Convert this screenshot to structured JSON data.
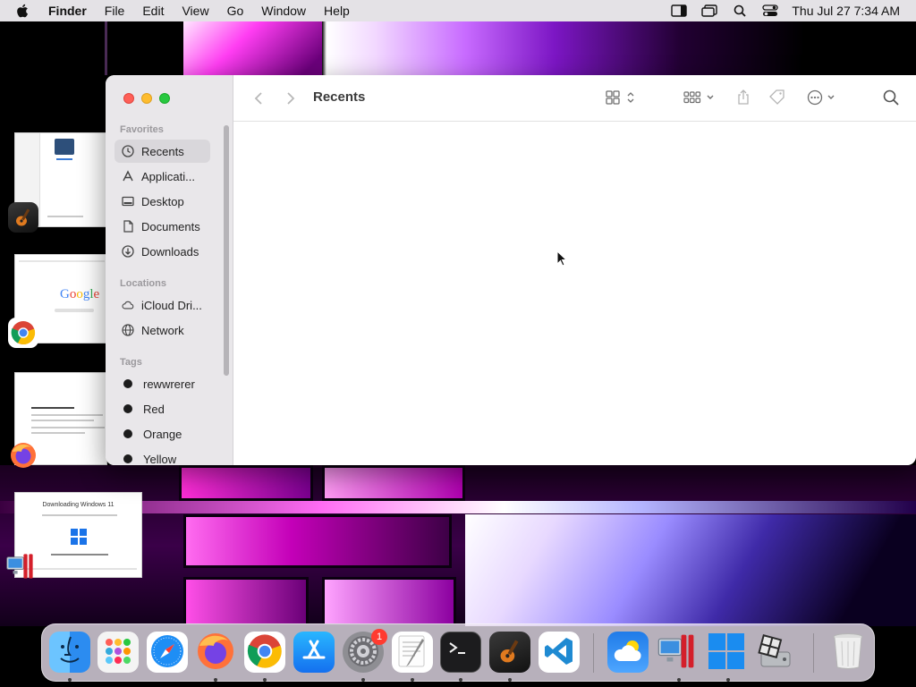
{
  "menubar": {
    "app_name": "Finder",
    "items": [
      "File",
      "Edit",
      "View",
      "Go",
      "Window",
      "Help"
    ],
    "clock": "Thu Jul 27  7:34 AM"
  },
  "thumbnails": {
    "google_text": [
      "G",
      "o",
      "o",
      "g",
      "l",
      "e"
    ],
    "installer_title": "Downloading Windows 11"
  },
  "finder": {
    "window_title": "Recents",
    "sidebar": {
      "favorites_header": "Favorites",
      "favorites": [
        {
          "label": "Recents",
          "icon": "clock-icon"
        },
        {
          "label": "Applicati...",
          "icon": "applications-icon"
        },
        {
          "label": "Desktop",
          "icon": "desktop-icon"
        },
        {
          "label": "Documents",
          "icon": "document-icon"
        },
        {
          "label": "Downloads",
          "icon": "download-icon"
        }
      ],
      "locations_header": "Locations",
      "locations": [
        {
          "label": "iCloud Dri...",
          "icon": "cloud-icon"
        },
        {
          "label": "Network",
          "icon": "globe-icon"
        }
      ],
      "tags_header": "Tags",
      "tags": [
        {
          "label": "rewwrerer"
        },
        {
          "label": "Red"
        },
        {
          "label": "Orange"
        },
        {
          "label": "Yellow"
        }
      ]
    }
  },
  "dock": {
    "settings_badge": "1"
  },
  "colors": {
    "accent": "#1a73e8",
    "close": "#fe5f57",
    "minimize": "#febc2e",
    "maximize": "#28c840",
    "badge": "#ff3b30"
  }
}
